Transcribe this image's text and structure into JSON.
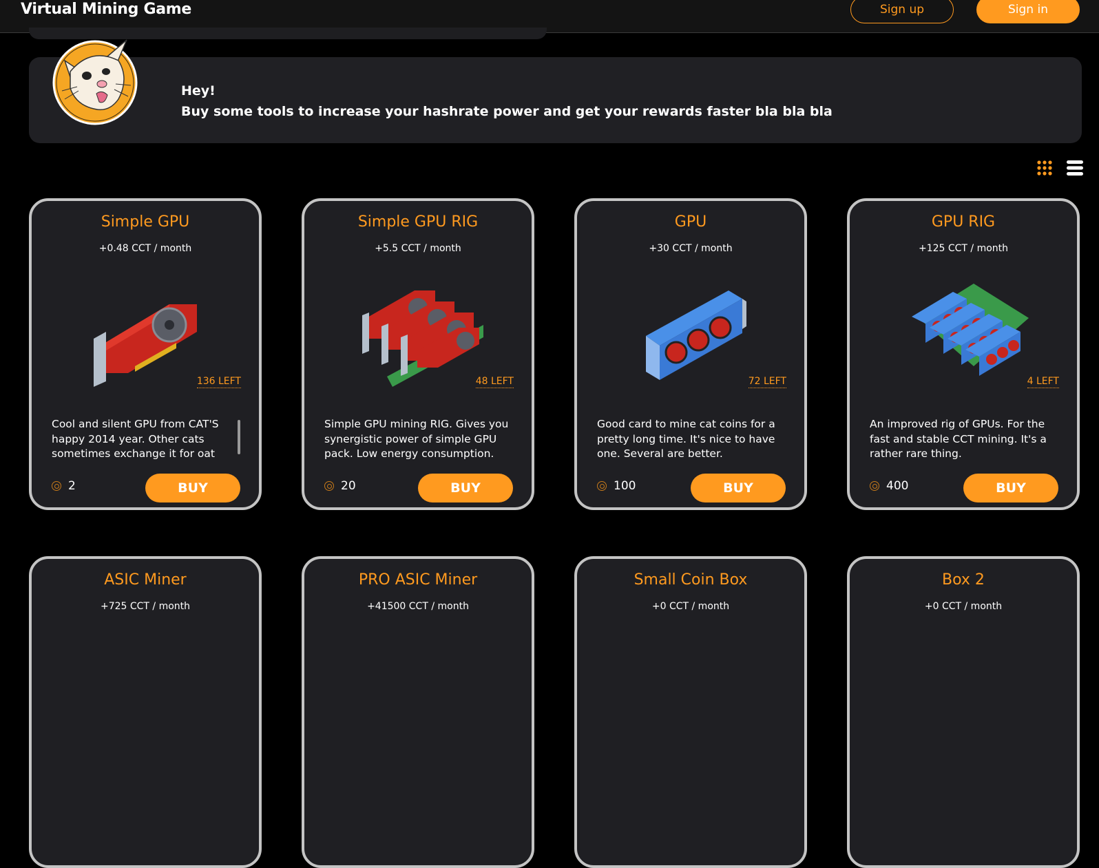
{
  "header": {
    "app_title": "Virtual Mining Game",
    "signup_label": "Sign up",
    "signin_label": "Sign in"
  },
  "banner": {
    "greeting": "Hey!",
    "message": "Buy some tools to increase your hashrate power and get your rewards faster bla bla bla"
  },
  "view_toggle": {
    "grid_icon": "grid-dots-icon",
    "list_icon": "list-icon",
    "active": "grid"
  },
  "colors": {
    "accent": "#ff9a1f",
    "card_bg": "#1f1f23",
    "card_border": "#c4c4c4"
  },
  "cards": [
    {
      "title": "Simple GPU",
      "rate": "+0.48 CCT / month",
      "left": "136 LEFT",
      "desc": "Cool and silent GPU from CAT'S happy 2014 year. Other cats sometimes exchange it for oat",
      "price": "2",
      "buy": "BUY"
    },
    {
      "title": "Simple GPU RIG",
      "rate": "+5.5 CCT / month",
      "left": "48 LEFT",
      "desc": "Simple GPU mining RIG. Gives you synergistic power of simple GPU pack. Low energy consumption.",
      "price": "20",
      "buy": "BUY"
    },
    {
      "title": "GPU",
      "rate": "+30 CCT / month",
      "left": "72 LEFT",
      "desc": "Good card to mine cat coins for a pretty long time. It's nice to have one. Several are better.",
      "price": "100",
      "buy": "BUY"
    },
    {
      "title": "GPU RIG",
      "rate": "+125 CCT / month",
      "left": "4 LEFT",
      "desc": "An improved rig of GPUs. For the fast and stable CCT mining. It's a rather rare thing.",
      "price": "400",
      "buy": "BUY"
    },
    {
      "title": "ASIC Miner",
      "rate": "+725 CCT / month"
    },
    {
      "title": "PRO ASIC Miner",
      "rate": "+41500 CCT / month"
    },
    {
      "title": "Small Coin Box",
      "rate": "+0 CCT / month"
    },
    {
      "title": "Box 2",
      "rate": "+0 CCT / month"
    }
  ]
}
